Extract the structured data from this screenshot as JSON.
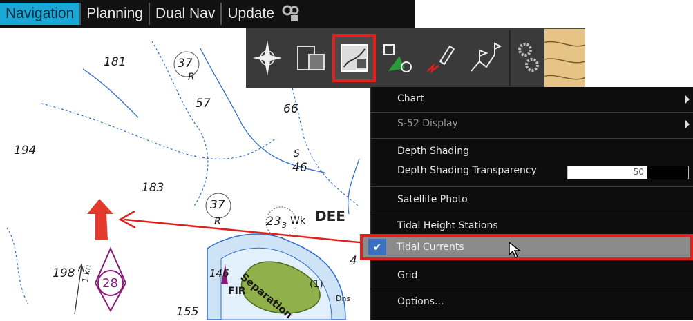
{
  "tabs": [
    {
      "label": "Navigation",
      "active": true
    },
    {
      "label": "Planning",
      "active": false
    },
    {
      "label": "Dual Nav",
      "active": false
    },
    {
      "label": "Update",
      "active": false
    }
  ],
  "toolbar": {
    "tools": [
      {
        "name": "compass-rose-icon"
      },
      {
        "name": "chart-documents-icon"
      },
      {
        "name": "chart-display-icon",
        "selected": true
      },
      {
        "name": "waypoint-tool-icon"
      },
      {
        "name": "vessel-track-icon"
      },
      {
        "name": "route-flags-icon"
      }
    ],
    "settings_icon": "gears-icon"
  },
  "menu": {
    "items": [
      {
        "label": "Chart",
        "submenu": true,
        "enabled": true
      },
      {
        "label": "S-52 Display",
        "submenu": true,
        "enabled": false
      },
      {
        "label": "Depth Shading",
        "enabled": true
      },
      {
        "label": "Depth Shading Transparency",
        "enabled": true,
        "slider_value": "50"
      },
      {
        "label": "Satellite Photo",
        "enabled": true
      },
      {
        "label": "Tidal Height Stations",
        "enabled": true
      },
      {
        "label": "Tidal Currents",
        "enabled": true,
        "checked": true
      },
      {
        "label": "Grid",
        "enabled": true
      },
      {
        "label": "Options...",
        "enabled": true
      }
    ]
  },
  "chart_labels": {
    "d181": "181",
    "d37a": "37",
    "r1": "R",
    "d57": "57",
    "d66": "66",
    "d194": "194",
    "s1": "S",
    "d46": "46",
    "d183": "183",
    "d37b": "37",
    "r2": "R",
    "d23": "23",
    "d3": "3",
    "wk": "Wk",
    "dee": "DEE",
    "d198": "198",
    "kn": "1 kn",
    "d28": "28",
    "d146": "146",
    "fir": "FIR",
    "separation": "Separation",
    "one": "(1)",
    "dns": "Dns",
    "d155": "155",
    "d4": "4"
  },
  "colors": {
    "accent_tab": "#1aa8d8",
    "highlight_red": "#e0201c",
    "tidal_arrow": "#e23a2c",
    "depth_line": "#2f6fd0",
    "tidal_diamond": "#8a1b7a"
  }
}
